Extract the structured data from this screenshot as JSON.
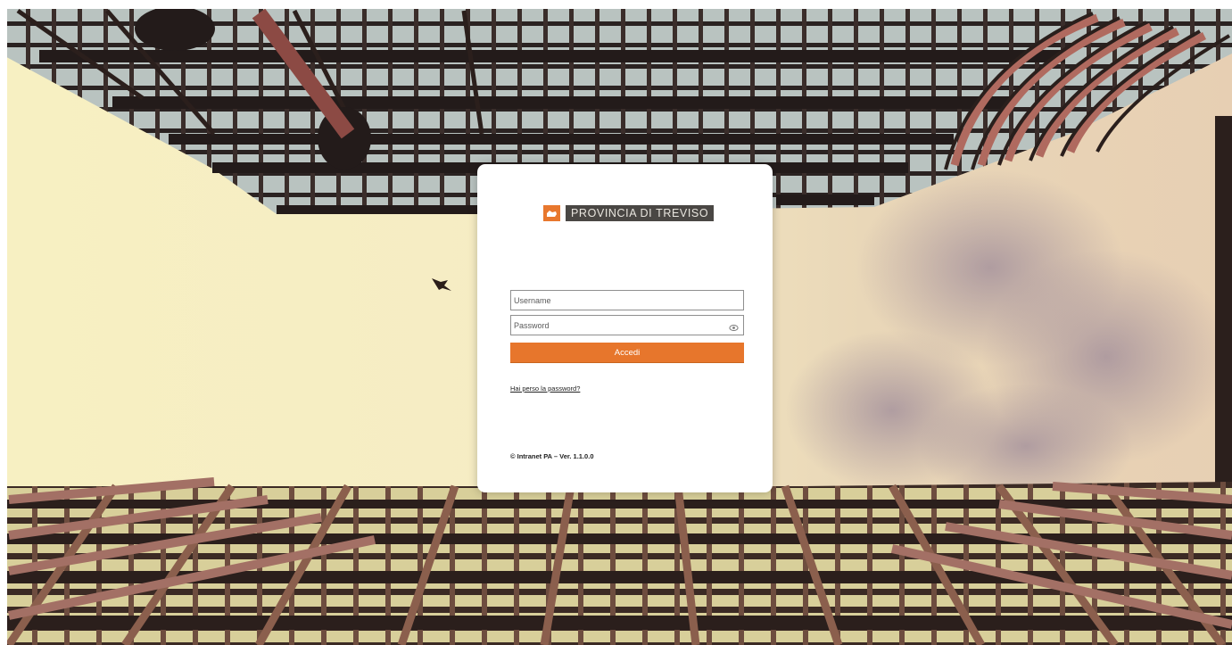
{
  "colors": {
    "accent": "#e7762c",
    "logo_bar": "#4a4744",
    "card": "#ffffff"
  },
  "logo": {
    "icon": "provincia-emblem-icon",
    "text": "PROVINCIA DI TREVISO"
  },
  "form": {
    "username_placeholder": "Username",
    "password_placeholder": "Password",
    "password_toggle_icon": "eye-icon",
    "submit_label": "Accedi",
    "forgot_link": "Hai perso la password?"
  },
  "footer": {
    "version": "© Intranet PA – Ver. 1.1.0.0"
  }
}
